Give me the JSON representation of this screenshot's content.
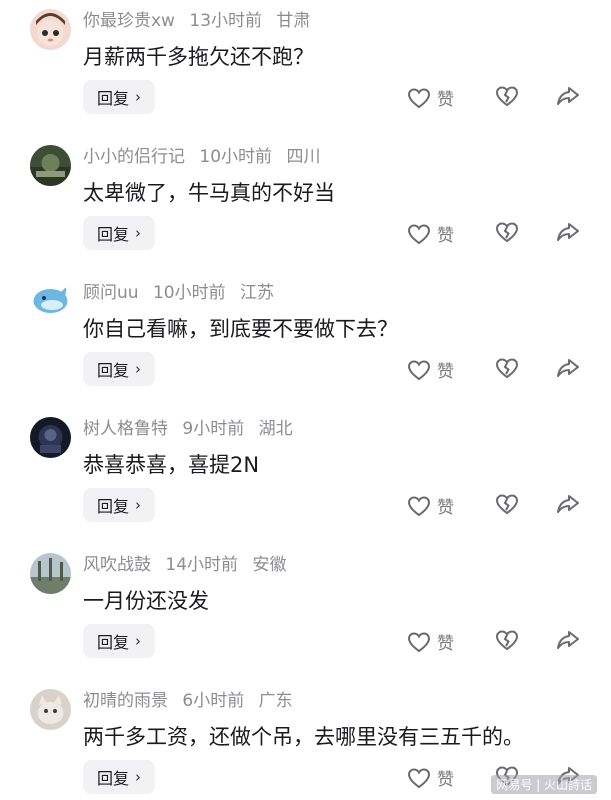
{
  "comments": [
    {
      "username": "你最珍贵xw",
      "time": "13小时前",
      "location": "甘肃",
      "text": "月薪两千多拖欠还不跑？",
      "reply_label": "回复",
      "like_label": "赞",
      "avatar_color": "#f3d9cf"
    },
    {
      "username": "小小的侣行记",
      "time": "10小时前",
      "location": "四川",
      "text": "太卑微了，牛马真的不好当",
      "reply_label": "回复",
      "like_label": "赞",
      "avatar_color": "#4a5a3c"
    },
    {
      "username": "顾问uu",
      "time": "10小时前",
      "location": "江苏",
      "text": "你自己看嘛，到底要不要做下去？",
      "reply_label": "回复",
      "like_label": "赞",
      "avatar_color": "#7ec3ea"
    },
    {
      "username": "树人格鲁特",
      "time": "9小时前",
      "location": "湖北",
      "text": "恭喜恭喜，喜提2N",
      "reply_label": "回复",
      "like_label": "赞",
      "avatar_color": "#1e2233"
    },
    {
      "username": "风吹战鼓",
      "time": "14小时前",
      "location": "安徽",
      "text": "一月份还没发",
      "reply_label": "回复",
      "like_label": "赞",
      "avatar_color": "#9fb0b8"
    },
    {
      "username": "初晴的雨景",
      "time": "6小时前",
      "location": "广东",
      "text": "两千多工资，还做个吊，去哪里没有三五千的。",
      "reply_label": "回复",
      "like_label": "赞",
      "avatar_color": "#c9bfb5"
    }
  ],
  "watermark": "网易号 | 火山詩话",
  "icons": {
    "chevron": "chevron-right-icon",
    "like": "heart-icon",
    "dislike": "broken-heart-icon",
    "share": "share-arrow-icon"
  }
}
